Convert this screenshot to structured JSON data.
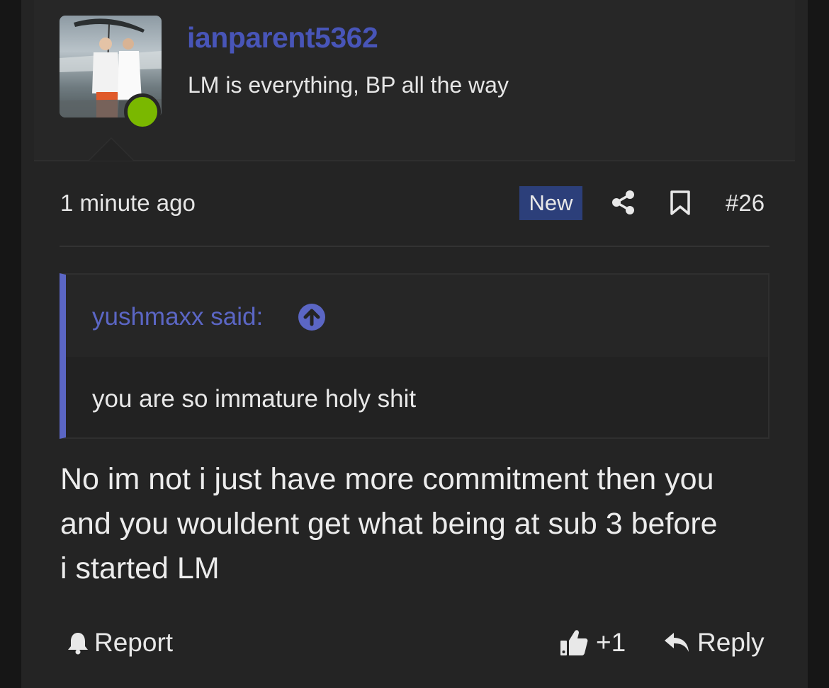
{
  "author": {
    "username": "ianparent5362",
    "user_title": "LM is everything, BP all the way",
    "status": "online",
    "colors": {
      "username": "#4855b8",
      "online": "#7ab800"
    }
  },
  "post_meta": {
    "time": "1 minute ago",
    "new_badge": "New",
    "share_icon": "share-icon",
    "bookmark_icon": "bookmark-icon",
    "post_number": "#26"
  },
  "quote": {
    "author_label": "yushmaxx said:",
    "up_icon": "arrow-up-circle-icon",
    "text": "you are so immature holy shit",
    "accent_color": "#5b66c4"
  },
  "post": {
    "body_lines": [
      "No im not i just have more commitment then you",
      "and you wouldent get what being at sub 3 before",
      "i started LM"
    ]
  },
  "actions": {
    "report_label": "Report",
    "like_count": "+1",
    "reply_label": "Reply"
  }
}
